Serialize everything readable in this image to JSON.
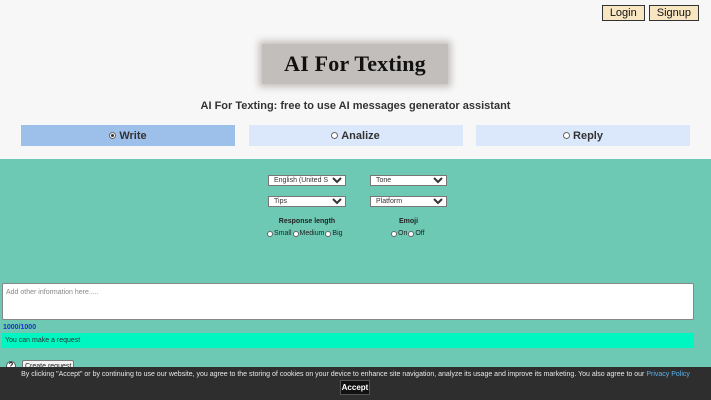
{
  "header": {
    "login_label": "Login",
    "signup_label": "Signup",
    "logo_text": "AI For Texting",
    "subtitle": "AI For Texting: free to use AI messages generator assistant"
  },
  "tabs": [
    {
      "label": "Write",
      "selected": true
    },
    {
      "label": "Analize",
      "selected": false
    },
    {
      "label": "Reply",
      "selected": false
    }
  ],
  "form": {
    "language": "English (United States)",
    "tone": "Tone",
    "tips": "Tips",
    "platform": "Platform",
    "response_length": {
      "label": "Response length",
      "options": [
        "Small",
        "Medium",
        "Big"
      ]
    },
    "emoji": {
      "label": "Emoji",
      "options": [
        "On",
        "Off"
      ]
    },
    "textarea_placeholder": "Add other information here.....",
    "counter": "1000/1000",
    "status": "You can make a request",
    "help_icon": "?",
    "create_label": "Create request"
  },
  "cookie": {
    "text": "By clicking \"Accept\" or by continuing to use our website, you agree to the storing of cookies on your device to enhance site navigation, analyze its usage and improve its marketing. You also agree to our ",
    "link": "Privacy Policy",
    "accept_label": "Accept"
  },
  "colors": {
    "panel": "#6ec9b4",
    "tab_active": "#9cc0ea",
    "tab_inactive": "#dbe7fb",
    "status_bar": "#00f6c0",
    "auth_button": "#f8e6c2",
    "counter": "#1a2fc8",
    "link": "#5ab4f0"
  }
}
